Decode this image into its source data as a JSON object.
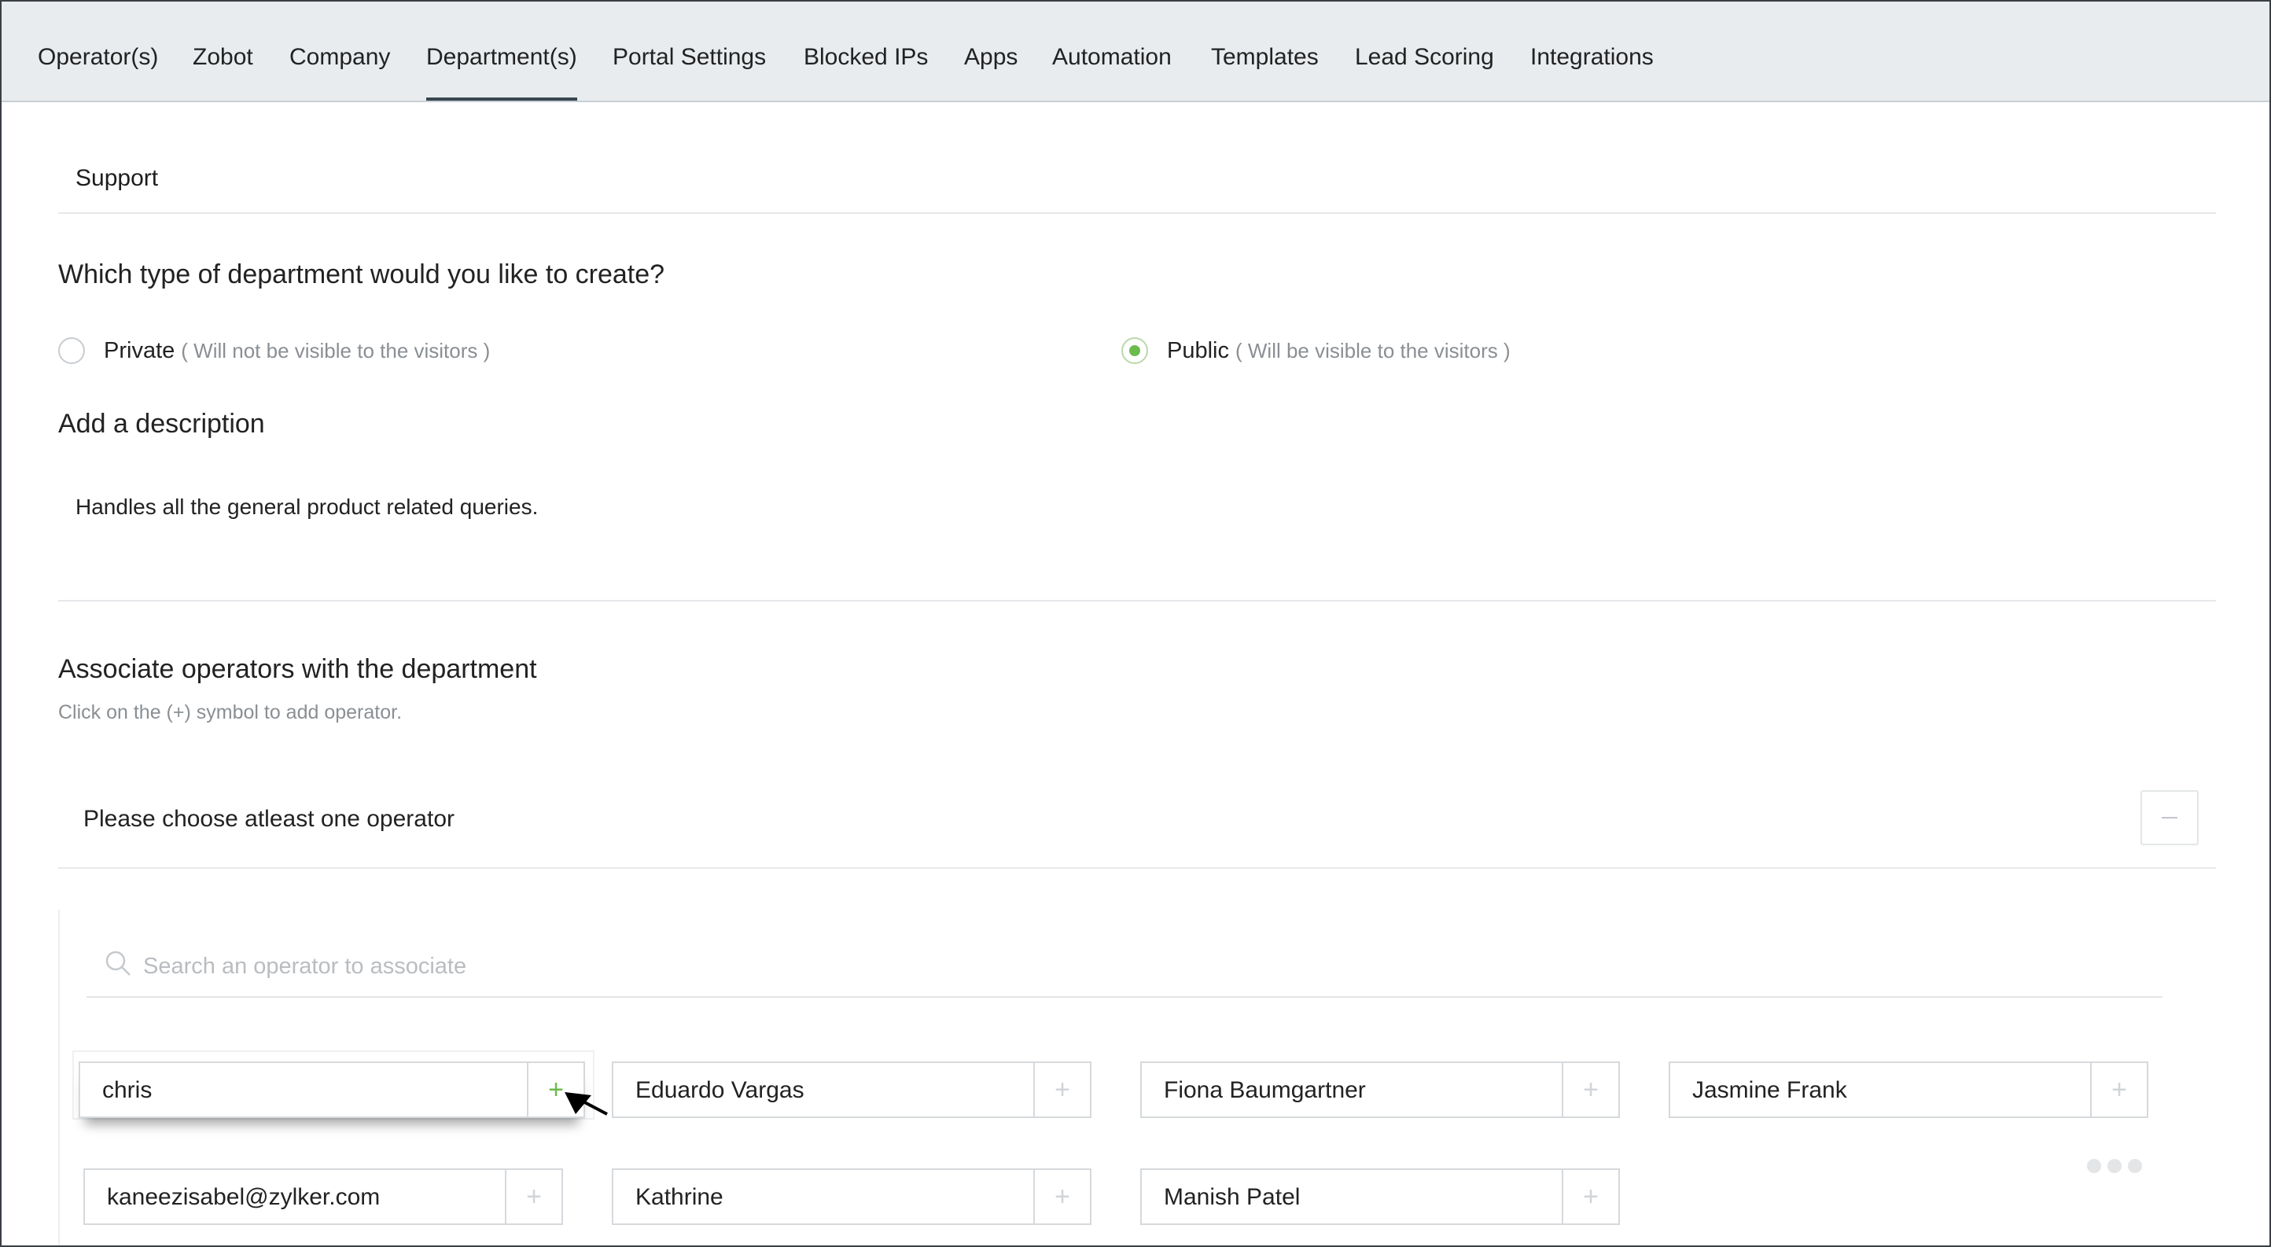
{
  "nav": {
    "tabs": [
      {
        "label": "Operator(s)"
      },
      {
        "label": "Zobot"
      },
      {
        "label": "Company"
      },
      {
        "label": "Department(s)",
        "active": true
      },
      {
        "label": "Portal Settings"
      },
      {
        "label": "Blocked IPs"
      },
      {
        "label": "Apps"
      },
      {
        "label": "Automation"
      },
      {
        "label": "Templates"
      },
      {
        "label": "Lead Scoring"
      },
      {
        "label": "Integrations"
      }
    ]
  },
  "department": {
    "name": "Support",
    "type_question": "Which type of department would you like to create?",
    "types": [
      {
        "label": "Private",
        "hint": "( Will not be visible to the visitors )",
        "selected": false
      },
      {
        "label": "Public",
        "hint": "( Will be visible to the visitors )",
        "selected": true
      }
    ],
    "description_title": "Add a description",
    "description": "Handles all the general product related queries."
  },
  "operators": {
    "title": "Associate operators with the department",
    "hint": "Click on the (+) symbol to add operator.",
    "empty_message": "Please choose atleast one operator",
    "search_placeholder": "Search an operator to associate",
    "list": [
      {
        "name": "chris",
        "add_symbol": "+"
      },
      {
        "name": "Eduardo Vargas",
        "add_symbol": "+"
      },
      {
        "name": "Fiona Baumgartner",
        "add_symbol": "+"
      },
      {
        "name": "Jasmine Frank",
        "add_symbol": "+"
      },
      {
        "name": "kaneezisabel@zylker.com",
        "add_symbol": "+"
      },
      {
        "name": "Kathrine",
        "add_symbol": "+"
      },
      {
        "name": "Manish Patel",
        "add_symbol": "+"
      }
    ]
  },
  "colors": {
    "accent_green": "#6cbb4c",
    "nav_bg": "#e8ecef",
    "active_tab_underline": "#36464f"
  }
}
